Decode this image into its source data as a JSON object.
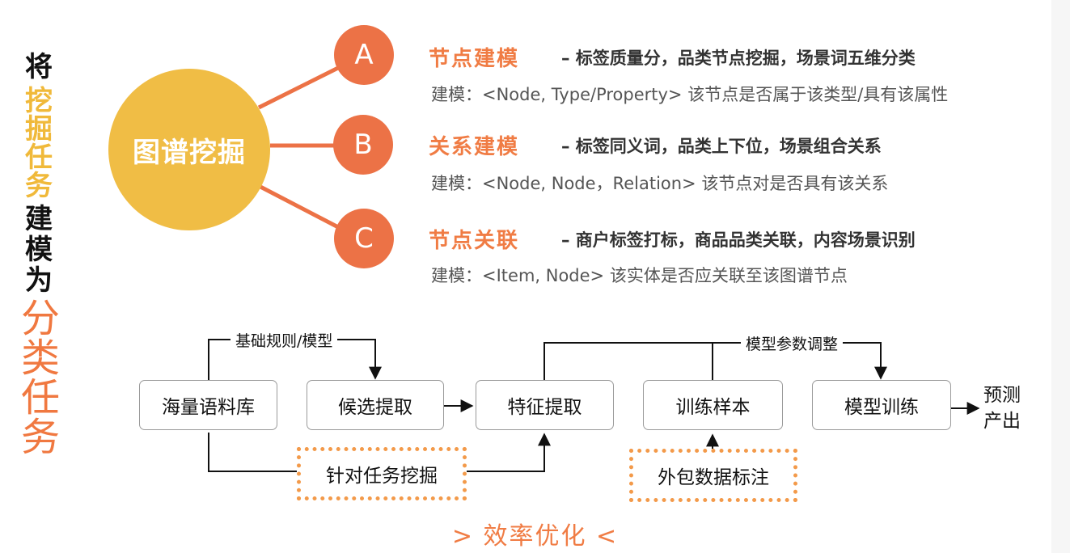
{
  "side_title": {
    "line1": "将",
    "line2": "挖掘任务",
    "line3": "建模为",
    "line4": "分类任务"
  },
  "center_node": "图谱挖掘",
  "branches": [
    {
      "badge": "A",
      "title": "节点建模",
      "desc": "– 标签质量分，品类节点挖掘，场景词五维分类",
      "model": "建模：<Node, Type/Property> 该节点是否属于该类型/具有该属性"
    },
    {
      "badge": "B",
      "title": "关系建模",
      "desc": "– 标签同义词，品类上下位，场景组合关系",
      "model": "建模：<Node, Node，Relation> 该节点对是否具有该关系"
    },
    {
      "badge": "C",
      "title": "节点关联",
      "desc": "– 商户标签打标，商品品类关联，内容场景识别",
      "model": "建模：<Item, Node> 该实体是否应关联至该图谱节点"
    }
  ],
  "flow": {
    "corpus": "海量语料库",
    "candidate": "候选提取",
    "feature": "特征提取",
    "samples": "训练样本",
    "training": "模型训练",
    "output": "预测产出",
    "rules_label": "基础规则/模型",
    "tuning_label": "模型参数调整",
    "task_mining": "针对任务挖掘",
    "outsourced": "外包数据标注"
  },
  "footer": "> 效率优化 <",
  "colors": {
    "yellow": "#f0bd45",
    "orange": "#ec7246",
    "title_orange": "#f07c44",
    "dotted_border": "#f39a4a"
  }
}
